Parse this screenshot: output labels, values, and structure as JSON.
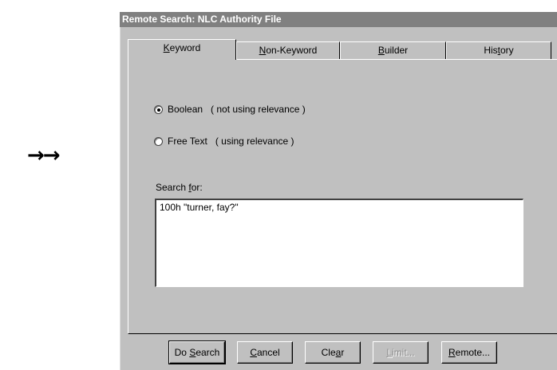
{
  "decor": {
    "arrows": "→→"
  },
  "window": {
    "title": "Remote Search: NLC Authority File"
  },
  "tabs": [
    {
      "pre": "",
      "mn": "K",
      "post": "eyword"
    },
    {
      "pre": "",
      "mn": "N",
      "post": "on-Keyword"
    },
    {
      "pre": "",
      "mn": "B",
      "post": "uilder"
    },
    {
      "pre": "His",
      "mn": "t",
      "post": "ory"
    }
  ],
  "options": {
    "boolean": {
      "label": "Boolean",
      "note": "( not using relevance )",
      "checked": true
    },
    "freetext": {
      "label": "Free Text",
      "note": "( using relevance )",
      "checked": false
    }
  },
  "search": {
    "label_pre": "Search ",
    "label_mn": "f",
    "label_post": "or:",
    "value": "100h \"turner, fay?\""
  },
  "buttons": {
    "do_search": {
      "pre": "Do ",
      "mn": "S",
      "post": "earch"
    },
    "cancel": {
      "pre": "",
      "mn": "C",
      "post": "ancel"
    },
    "clear": {
      "pre": "Cle",
      "mn": "a",
      "post": "r"
    },
    "limit": {
      "pre": "",
      "mn": "L",
      "post": "imit..."
    },
    "remote": {
      "pre": "",
      "mn": "R",
      "post": "emote..."
    }
  }
}
